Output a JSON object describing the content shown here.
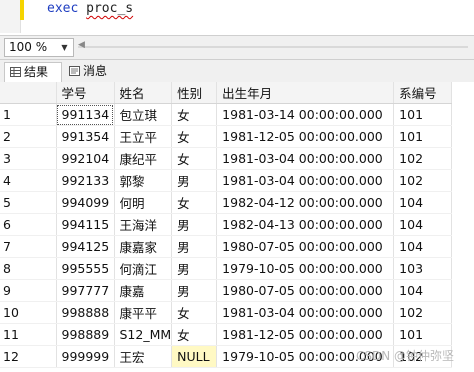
{
  "editor": {
    "keyword": "exec",
    "procedure": "proc_s"
  },
  "zoom": {
    "value": "100 %"
  },
  "tabs": [
    {
      "label": "结果",
      "icon": "grid-icon"
    },
    {
      "label": "消息",
      "icon": "message-icon"
    }
  ],
  "grid": {
    "columns": [
      "学号",
      "姓名",
      "性别",
      "出生年月",
      "系编号"
    ],
    "rows": [
      {
        "n": "1",
        "id": "991134",
        "name": "包立琪",
        "sex": "女",
        "birth": "1981-03-14 00:00:00.000",
        "dept": "101"
      },
      {
        "n": "2",
        "id": "991354",
        "name": "王立平",
        "sex": "女",
        "birth": "1981-12-05 00:00:00.000",
        "dept": "101"
      },
      {
        "n": "3",
        "id": "992104",
        "name": "康纪平",
        "sex": "女",
        "birth": "1981-03-04 00:00:00.000",
        "dept": "102"
      },
      {
        "n": "4",
        "id": "992133",
        "name": "郭黎",
        "sex": "男",
        "birth": "1981-03-04 00:00:00.000",
        "dept": "102"
      },
      {
        "n": "5",
        "id": "994099",
        "name": "何明",
        "sex": "女",
        "birth": "1982-04-12 00:00:00.000",
        "dept": "104"
      },
      {
        "n": "6",
        "id": "994115",
        "name": "王海洋",
        "sex": "男",
        "birth": "1982-04-13 00:00:00.000",
        "dept": "104"
      },
      {
        "n": "7",
        "id": "994125",
        "name": "康嘉家",
        "sex": "男",
        "birth": "1980-07-05 00:00:00.000",
        "dept": "104"
      },
      {
        "n": "8",
        "id": "995555",
        "name": "何滴江",
        "sex": "男",
        "birth": "1979-10-05 00:00:00.000",
        "dept": "103"
      },
      {
        "n": "9",
        "id": "997777",
        "name": "康嘉",
        "sex": "男",
        "birth": "1980-07-05 00:00:00.000",
        "dept": "104"
      },
      {
        "n": "10",
        "id": "998888",
        "name": "康平平",
        "sex": "女",
        "birth": "1981-03-04 00:00:00.000",
        "dept": "102"
      },
      {
        "n": "11",
        "id": "998889",
        "name": "S12_MM",
        "sex": "女",
        "birth": "1981-12-05 00:00:00.000",
        "dept": "101"
      },
      {
        "n": "12",
        "id": "999999",
        "name": "王宏",
        "sex": "NULL",
        "birth": "1979-10-05 00:00:00.000",
        "dept": "102"
      }
    ]
  },
  "watermark": "CSDN @钟仲弥坚"
}
